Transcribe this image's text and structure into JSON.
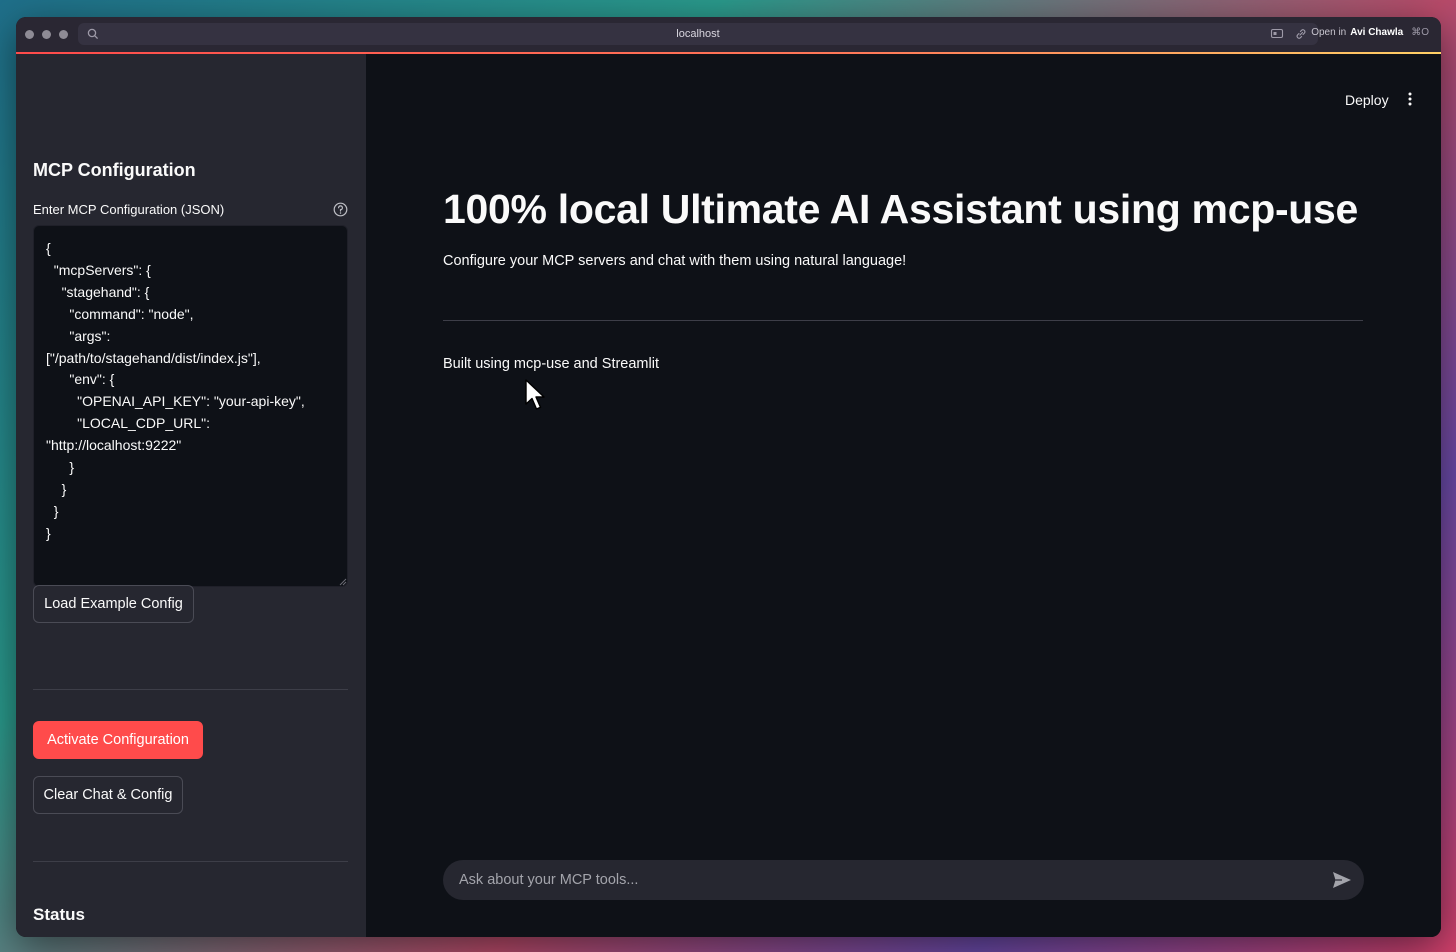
{
  "browser": {
    "url": "localhost",
    "open_in_prefix": "Open in",
    "open_in_name": "Avi Chawla",
    "open_in_shortcut": "⌘O"
  },
  "sidebar": {
    "title": "MCP Configuration",
    "config_label": "Enter MCP Configuration (JSON)",
    "config_value": "{\n  \"mcpServers\": {\n    \"stagehand\": {\n      \"command\": \"node\",\n      \"args\":\n[\"/path/to/stagehand/dist/index.js\"],\n      \"env\": {\n        \"OPENAI_API_KEY\": \"your-api-key\",\n        \"LOCAL_CDP_URL\":\n\"http://localhost:9222\"\n      }\n    }\n  }\n}",
    "load_example_label": "Load Example Config",
    "activate_label": "Activate Configuration",
    "clear_label": "Clear Chat & Config",
    "status_title": "Status"
  },
  "header": {
    "deploy_label": "Deploy"
  },
  "main": {
    "title": "100% local Ultimate AI Assistant using mcp-use",
    "subtitle": "Configure your MCP servers and chat with them using natural language!",
    "built_using": "Built using mcp-use and Streamlit",
    "chat_placeholder": "Ask about your MCP tools..."
  },
  "colors": {
    "primary": "#ff4b4b",
    "background": "#0e1117",
    "sidebar": "#262730"
  }
}
